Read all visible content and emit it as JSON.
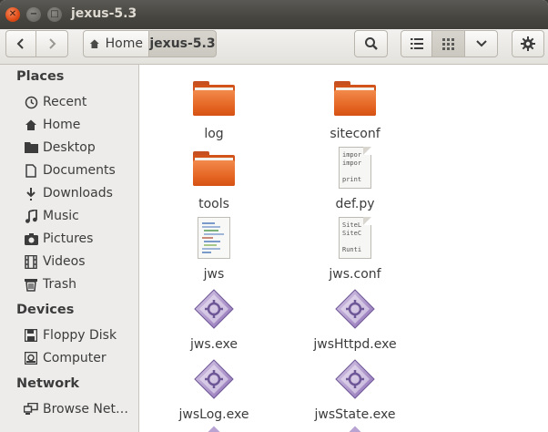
{
  "window": {
    "title": "jexus-5.3"
  },
  "breadcrumb": {
    "home": "Home",
    "current": "jexus-5.3"
  },
  "sidebar": {
    "places_header": "Places",
    "places": [
      {
        "label": "Recent",
        "icon": "recent-icon"
      },
      {
        "label": "Home",
        "icon": "home-icon"
      },
      {
        "label": "Desktop",
        "icon": "desktop-icon"
      },
      {
        "label": "Documents",
        "icon": "documents-icon"
      },
      {
        "label": "Downloads",
        "icon": "downloads-icon"
      },
      {
        "label": "Music",
        "icon": "music-icon"
      },
      {
        "label": "Pictures",
        "icon": "pictures-icon"
      },
      {
        "label": "Videos",
        "icon": "videos-icon"
      },
      {
        "label": "Trash",
        "icon": "trash-icon"
      }
    ],
    "devices_header": "Devices",
    "devices": [
      {
        "label": "Floppy Disk",
        "icon": "floppy-icon"
      },
      {
        "label": "Computer",
        "icon": "computer-icon"
      }
    ],
    "network_header": "Network",
    "network": [
      {
        "label": "Browse Net…",
        "icon": "network-icon"
      }
    ]
  },
  "files": [
    {
      "name": "log",
      "type": "folder"
    },
    {
      "name": "siteconf",
      "type": "folder"
    },
    {
      "name": "tools",
      "type": "folder"
    },
    {
      "name": "def.py",
      "type": "text",
      "preview": "impor\nimpor\n\nprint"
    },
    {
      "name": "jws",
      "type": "script"
    },
    {
      "name": "jws.conf",
      "type": "text",
      "preview": "SiteL\nSiteC\n\nRunti"
    },
    {
      "name": "jws.exe",
      "type": "exe"
    },
    {
      "name": "jwsHttpd.exe",
      "type": "exe"
    },
    {
      "name": "jwsLog.exe",
      "type": "exe"
    },
    {
      "name": "jwsState.exe",
      "type": "exe"
    }
  ],
  "colors": {
    "accent": "#df4b16",
    "folder": "#e3611f",
    "titlebar": "#46453f",
    "exe": "#8e6fb5"
  }
}
